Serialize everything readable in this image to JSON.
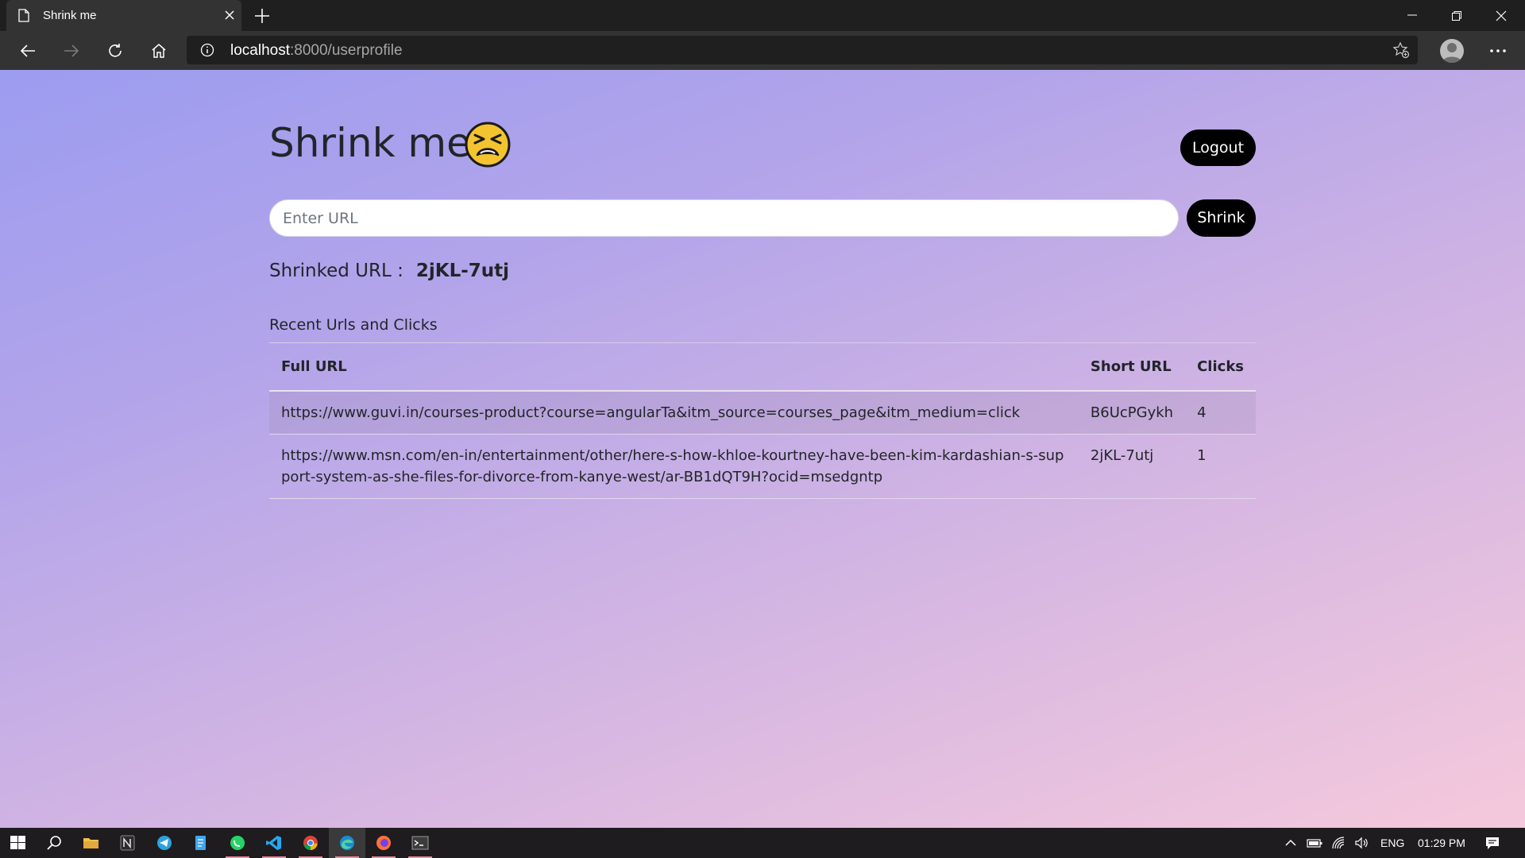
{
  "browser": {
    "tab_title": "Shrink me",
    "url_host": "localhost",
    "url_path": ":8000/userprofile"
  },
  "app": {
    "brand": "Shrink me",
    "logout_label": "Logout",
    "url_placeholder": "Enter URL",
    "url_value": "",
    "shrink_label": "Shrink",
    "result_label": "Shrinked URL :",
    "result_value": "2jKL-7utj",
    "recent_title": "Recent Urls and Clicks",
    "table": {
      "headers": [
        "Full URL",
        "Short URL",
        "Clicks"
      ],
      "rows": [
        {
          "full_url": "https://www.guvi.in/courses-product?course=angularTa&itm_source=courses_page&itm_medium=click",
          "short_url": "B6UcPGykh",
          "clicks": "4"
        },
        {
          "full_url": "https://www.msn.com/en-in/entertainment/other/here-s-how-khloe-kourtney-have-been-kim-kardashian-s-support-system-as-she-files-for-divorce-from-kanye-west/ar-BB1dQT9H?ocid=msedgntp",
          "short_url": "2jKL-7utj",
          "clicks": "1"
        }
      ]
    }
  },
  "taskbar": {
    "language": "ENG",
    "time": "01:29 PM",
    "apps": [
      "start-icon",
      "search-icon",
      "file-explorer-icon",
      "notion-icon",
      "telegram-icon",
      "notepad-icon",
      "whatsapp-icon",
      "vscode-icon",
      "chrome-icon",
      "edge-icon",
      "firefox-icon",
      "terminal-icon"
    ]
  },
  "colors": {
    "page_gradient_start": "#9c9cf0",
    "page_gradient_end": "#f5c9dc",
    "button_bg": "#000000",
    "chrome_bg": "#333333"
  }
}
